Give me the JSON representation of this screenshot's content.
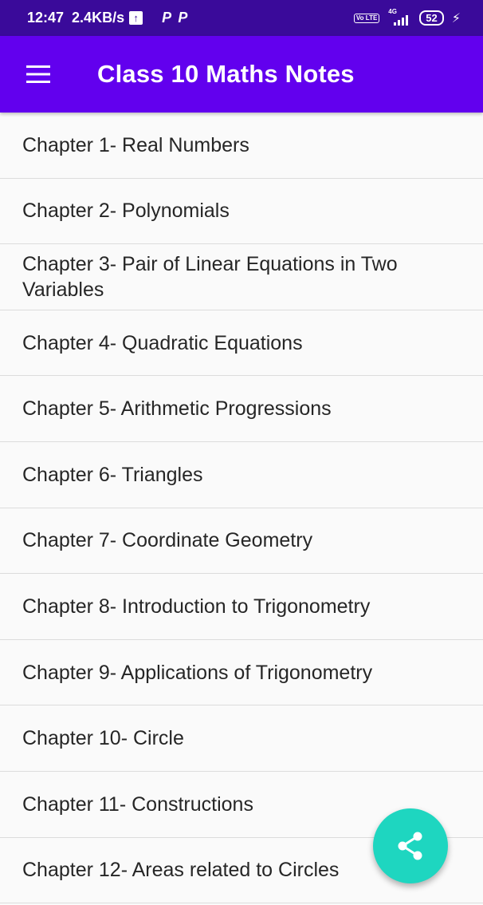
{
  "status_bar": {
    "time": "12:47",
    "speed": "2.4KB/s",
    "upload_icon": "↑",
    "notification_icons": "P P",
    "volte_label": "Vo LTE",
    "network_type": "4G",
    "battery_level": "52",
    "charging_icon": "⚡"
  },
  "app_bar": {
    "title": "Class 10 Maths Notes",
    "menu_icon": "hamburger-menu-icon"
  },
  "chapters": [
    "Chapter 1- Real Numbers",
    "Chapter 2- Polynomials",
    "Chapter 3- Pair of Linear Equations in Two Variables",
    "Chapter 4- Quadratic Equations",
    "Chapter 5- Arithmetic Progressions",
    "Chapter 6- Triangles",
    "Chapter 7- Coordinate Geometry",
    "Chapter 8- Introduction to Trigonometry",
    "Chapter 9- Applications of Trigonometry",
    "Chapter 10- Circle",
    "Chapter 11- Constructions",
    "Chapter 12- Areas related to Circles"
  ],
  "fab": {
    "icon": "share-icon",
    "color": "#1ed6c0"
  },
  "colors": {
    "status_bar": "#3a0a9a",
    "app_bar": "#6200ee",
    "background": "#fafafa",
    "text": "#262626",
    "divider": "#dcdcdc"
  }
}
